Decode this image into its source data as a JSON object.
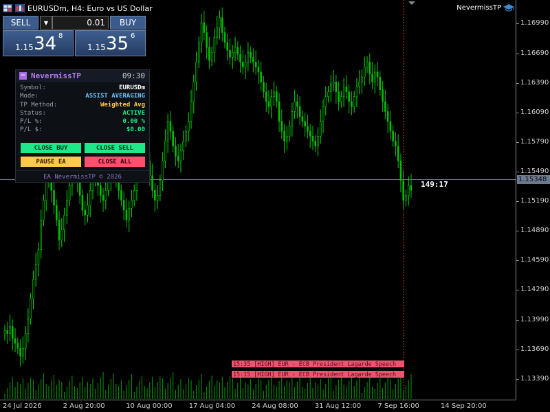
{
  "window": {
    "symbol_title": "EURUSDm, H4:  Euro vs US Dollar",
    "brand": "NevermissTP"
  },
  "trade_panel": {
    "sell_label": "SELL",
    "buy_label": "BUY",
    "lot": "0.01",
    "bid_prefix": "1.15",
    "bid_big": "34",
    "bid_sup": "8",
    "ask_prefix": "1.15",
    "ask_big": "35",
    "ask_sup": "6"
  },
  "info_panel": {
    "minimize_symbol": "−",
    "title": "NevermissTP",
    "time": "09:30",
    "rows": [
      {
        "label": "Symbol:",
        "value": "EURUSDm"
      },
      {
        "label": "Mode:",
        "value": "ASSIST AVERAGING"
      },
      {
        "label": "TP Method:",
        "value": "Weighted Avg"
      },
      {
        "label": "Status:",
        "value": "ACTIVE"
      },
      {
        "label": "P/L %:",
        "value": "0.00 %"
      },
      {
        "label": "P/L $:",
        "value": "$0.00"
      }
    ],
    "buttons": {
      "close_buy": "CLOSE BUY",
      "close_sell": "CLOSE SELL",
      "pause": "PAUSE EA",
      "close_all": "CLOSE ALL"
    },
    "footer": "EA NevermissTP © 2026"
  },
  "countdown": "149:17",
  "price_axis": {
    "labels": [
      "1.16990",
      "1.16690",
      "1.16390",
      "1.16090",
      "1.15790",
      "1.15490",
      "1.15190",
      "1.14890",
      "1.14590",
      "1.14290",
      "1.13990",
      "1.13690",
      "1.13390"
    ],
    "current": "1.15348"
  },
  "time_axis": {
    "labels": [
      "24 Jul 2026",
      "2 Aug 20:00",
      "10 Aug 00:00",
      "17 Aug 04:00",
      "24 Aug 08:00",
      "31 Aug 12:00",
      "7 Sep 16:00",
      "14 Sep 20:00"
    ]
  },
  "news": [
    "15:35 [HIGH] EUR - ECB President Lagarde Speech",
    "15:15 [HIGH] EUR - ECB President Lagarde Speech"
  ],
  "colors": {
    "bull": "#00e000",
    "bear": "#00c000",
    "volume": "#00a000",
    "button_green": "#1ee88a",
    "button_red": "#ff4f6e",
    "button_yellow": "#ffc94a",
    "accent_purple": "#b07cf0"
  },
  "chart_data": {
    "type": "candlestick",
    "ylim": [
      1.1318,
      1.1723
    ],
    "close_series": [
      1.1388,
      1.1385,
      1.1392,
      1.138,
      1.1375,
      1.137,
      1.1362,
      1.137,
      1.1385,
      1.14,
      1.142,
      1.144,
      1.1455,
      1.147,
      1.15,
      1.152,
      1.154,
      1.1545,
      1.153,
      1.1515,
      1.15,
      1.148,
      1.149,
      1.1505,
      1.152,
      1.1535,
      1.1545,
      1.1555,
      1.154,
      1.1525,
      1.151,
      1.1505,
      1.1515,
      1.153,
      1.154,
      1.1545,
      1.1535,
      1.1525,
      1.152,
      1.153,
      1.154,
      1.1545,
      1.155,
      1.1545,
      1.153,
      1.152,
      1.151,
      1.15,
      1.1512,
      1.152,
      1.153,
      1.1545,
      1.1558,
      1.1565,
      1.1572,
      1.156,
      1.1545,
      1.153,
      1.152,
      1.1525,
      1.154,
      1.156,
      1.158,
      1.16,
      1.159,
      1.1575,
      1.1565,
      1.156,
      1.157,
      1.158,
      1.159,
      1.16,
      1.162,
      1.164,
      1.166,
      1.168,
      1.17,
      1.169,
      1.1675,
      1.1662,
      1.167,
      1.1685,
      1.1695,
      1.1705,
      1.169,
      1.168,
      1.1672,
      1.1665,
      1.167,
      1.1675,
      1.1668,
      1.166,
      1.1655,
      1.166,
      1.167,
      1.1665,
      1.166,
      1.1655,
      1.165,
      1.164,
      1.163,
      1.162,
      1.1615,
      1.1625,
      1.163,
      1.162,
      1.16,
      1.159,
      1.158,
      1.1585,
      1.1595,
      1.161,
      1.162,
      1.1615,
      1.1605,
      1.16,
      1.1595,
      1.159,
      1.1585,
      1.158,
      1.1575,
      1.1585,
      1.16,
      1.1615,
      1.1625,
      1.163,
      1.1638,
      1.164,
      1.163,
      1.162,
      1.1625,
      1.1635,
      1.163,
      1.162,
      1.1615,
      1.1625,
      1.1635,
      1.164,
      1.1645,
      1.1655,
      1.166,
      1.1648,
      1.164,
      1.165,
      1.1645,
      1.1632,
      1.162,
      1.161,
      1.16,
      1.159,
      1.158,
      1.1575,
      1.156,
      1.154,
      1.152,
      1.1525,
      1.1535,
      1.153
    ]
  }
}
